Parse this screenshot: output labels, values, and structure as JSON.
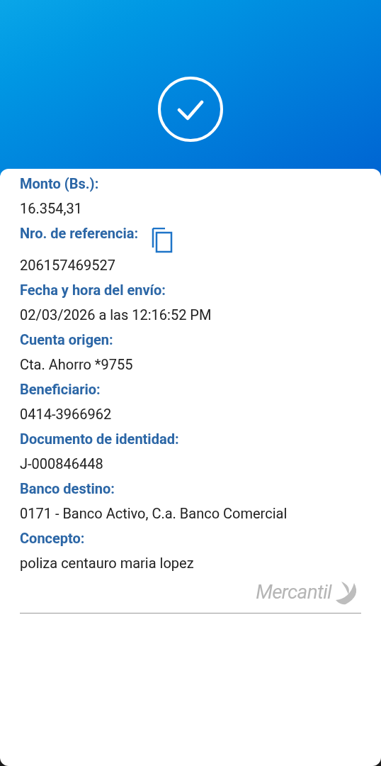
{
  "fields": [
    {
      "label": "Monto (Bs.):",
      "value": "16.354,31",
      "copy_button": false
    },
    {
      "label": "Nro. de referencia:",
      "value": "206157469527",
      "copy_button": true
    },
    {
      "label": "Fecha y hora del envío:",
      "value": "02/03/2026 a las 12:16:52 PM",
      "copy_button": false
    },
    {
      "label": "Cuenta origen:",
      "value": "Cta. Ahorro *9755",
      "copy_button": false
    },
    {
      "label": "Beneficiario:",
      "value": "0414-3966962",
      "copy_button": false
    },
    {
      "label": "Documento de identidad:",
      "value": "J-000846448",
      "copy_button": false
    },
    {
      "label": "Banco destino:",
      "value": "0171 - Banco Activo, C.a. Banco Comercial",
      "copy_button": false
    },
    {
      "label": "Concepto:",
      "value": "poliza centauro maria lopez",
      "copy_button": false
    }
  ],
  "logo": {
    "text": "Mercantil"
  }
}
